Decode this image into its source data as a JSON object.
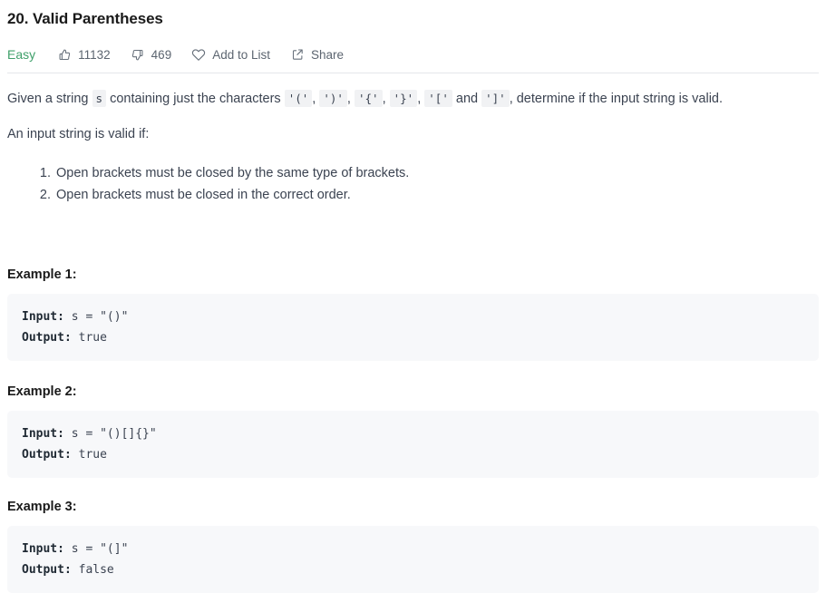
{
  "problem": {
    "title": "20. Valid Parentheses",
    "difficulty": "Easy",
    "likes": "11132",
    "dislikes": "469",
    "add_to_list_label": "Add to List",
    "share_label": "Share",
    "icons": {
      "thumbs_up": "thumbs-up-icon",
      "thumbs_down": "thumbs-down-icon",
      "heart": "heart-icon",
      "share": "share-icon"
    }
  },
  "description": {
    "intro_1": "Given a string",
    "code_s": "s",
    "intro_2": "containing just the characters",
    "char_1": "'('",
    "char_2": "')'",
    "char_3": "'{'",
    "char_4": "'}'",
    "char_5": "'['",
    "conj": "and",
    "char_6": "']'",
    "intro_3": ", determine if the input string is valid.",
    "comma": ",",
    "valid_if": "An input string is valid if:",
    "rules": [
      "Open brackets must be closed by the same type of brackets.",
      "Open brackets must be closed in the correct order."
    ]
  },
  "examples": [
    {
      "heading": "Example 1:",
      "input_label": "Input:",
      "input_value": " s = \"()\"",
      "output_label": "Output:",
      "output_value": " true"
    },
    {
      "heading": "Example 2:",
      "input_label": "Input:",
      "input_value": " s = \"()[]{}\"",
      "output_label": "Output:",
      "output_value": " true"
    },
    {
      "heading": "Example 3:",
      "input_label": "Input:",
      "input_value": " s = \"(]\"",
      "output_label": "Output:",
      "output_value": " false"
    }
  ],
  "colors": {
    "easy_green": "#3fa06a",
    "body_text": "#3b4351",
    "title_text": "#1a1a1a",
    "code_bg": "#f7f8fa",
    "inline_code_bg": "#f1f2f4",
    "divider": "#e4e6ea"
  }
}
